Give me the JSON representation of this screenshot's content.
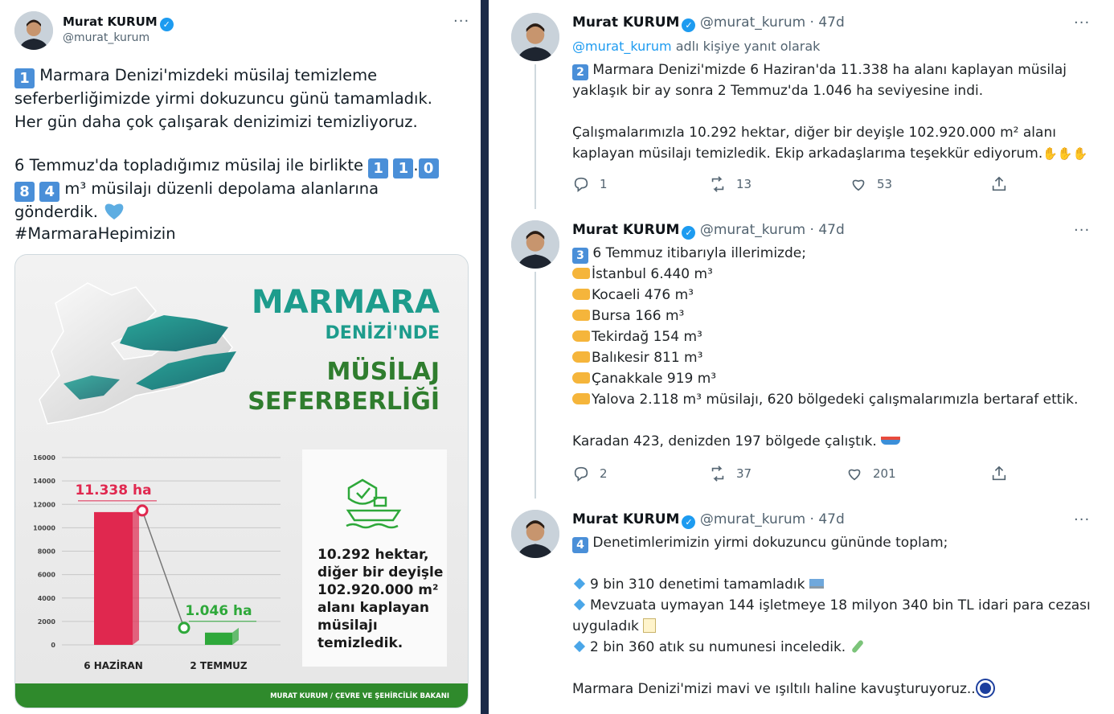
{
  "left_tweet": {
    "author_name": "Murat KURUM",
    "author_handle": "@murat_kurum",
    "more_label": "···",
    "line1_key": "1",
    "line1_text": " Marmara Denizi'mizdeki müsilaj temizleme",
    "line2": "seferberliğimizde yirmi dokuzuncu günü tamamladık.",
    "line3": "Her gün daha çok çalışarak denizimizi temizliyoruz.",
    "line4_text": "6 Temmuz'da topladığımız müsilaj ile birlikte ",
    "line4_keys": [
      "1",
      "1",
      ".",
      "0"
    ],
    "line5_keys": [
      "8",
      "4"
    ],
    "line5_text": " m³ müsilajı düzenli depolama alanlarına",
    "line6": "gönderdik.",
    "hashtag": "#MarmaraHepimizin"
  },
  "infographic": {
    "title1": "MARMARA",
    "title2": "DENİZİ'NDE",
    "title3": "MÜSİLAJ",
    "title4": "SEFERBERLİĞİ",
    "summary_lines": [
      "10.292 hektar,",
      "diğer bir deyişle",
      "102.920.000 m²",
      "alanı kaplayan",
      "müsilajı",
      "temizledik."
    ],
    "footer": "MURAT KURUM / ÇEVRE VE ŞEHİRCİLİK BAKANI",
    "chart_data": {
      "type": "bar",
      "categories": [
        "6 HAZİRAN",
        "2 TEMMUZ"
      ],
      "values": [
        11338,
        1046
      ],
      "data_labels": [
        "11.338 ha",
        "1.046 ha"
      ],
      "yticks": [
        "16000",
        "14000",
        "12000",
        "10000",
        "8000",
        "6000",
        "4000",
        "2000",
        "0"
      ],
      "ylim": [
        0,
        16000
      ],
      "colors": {
        "bar1": "#e0284f",
        "bar2": "#2ea83a",
        "title_teal": "#1d9c8c",
        "title_green": "#2f7d2e"
      }
    }
  },
  "right_tweets": [
    {
      "name": "Murat KURUM",
      "meta": "@murat_kurum · 47d",
      "reply_to_handle": "@murat_kurum",
      "reply_to_text": " adlı kişiye yanıt olarak",
      "key": "2",
      "lines": [
        " Marmara Denizi'mizde 6 Haziran'da 11.338 ha alanı kaplayan müsilaj",
        "yaklaşık bir ay sonra 2 Temmuz'da 1.046 ha seviyesine indi.",
        "",
        "Çalışmalarımızla 10.292 hektar, diğer bir deyişle 102.920.000 m² alanı",
        "kaplayan müsilajı temizledik. Ekip arkadaşlarıma teşekkür ediyorum."
      ],
      "replies": "1",
      "retweets": "13",
      "likes": "53"
    },
    {
      "name": "Murat KURUM",
      "meta": "@murat_kurum · 47d",
      "key": "3",
      "first_line": " 6 Temmuz itibarıyla illerimizde;",
      "items": [
        "İstanbul 6.440 m³",
        "Kocaeli 476 m³",
        "Bursa 166 m³",
        "Tekirdağ 154 m³",
        "Balıkesir 811 m³",
        "Çanakkale 919 m³",
        "Yalova 2.118 m³ müsilajı, 620 bölgedeki çalışmalarımızla bertaraf ettik."
      ],
      "closing": "Karadan 423, denizden 197 bölgede çalıştık.",
      "replies": "2",
      "retweets": "37",
      "likes": "201"
    },
    {
      "name": "Murat KURUM",
      "meta": "@murat_kurum · 47d",
      "key": "4",
      "first_line": " Denetimlerimizin yirmi dokuzuncu gününde toplam;",
      "bullets": [
        "9 bin 310 denetimi tamamladık",
        "Mevzuata uymayan 144 işletmeye 18 milyon 340 bin TL idari para cezası",
        "2 bin 360 atık su numunesi inceledik."
      ],
      "bullet2_cont": "uyguladık",
      "closing": "Marmara Denizi'mizi mavi ve ışıltılı haline kavuşturuyoruz.."
    }
  ]
}
